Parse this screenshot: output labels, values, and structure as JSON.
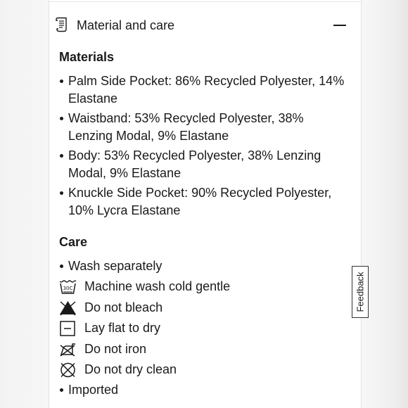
{
  "accordion": {
    "title": "Material and care",
    "icon": "document-icon",
    "toggle_icon": "minus-icon"
  },
  "materials": {
    "heading": "Materials",
    "items": [
      "Palm Side Pocket: 86% Recycled Polyester, 14% Elastane",
      "Waistband: 53% Recycled Polyester, 38% Lenzing Modal, 9% Elastane",
      "Body: 53% Recycled Polyester, 38% Lenzing Modal, 9% Elastane",
      "Knuckle Side Pocket: 90% Recycled Polyester, 10% Lycra Elastane"
    ]
  },
  "care": {
    "heading": "Care",
    "items": [
      {
        "label": "Wash separately",
        "icon": "bullet"
      },
      {
        "label": "Machine wash cold gentle",
        "icon": "wash-30c-icon",
        "icon_text": "30C"
      },
      {
        "label": "Do not bleach",
        "icon": "do-not-bleach-icon"
      },
      {
        "label": "Lay flat to dry",
        "icon": "lay-flat-dry-icon"
      },
      {
        "label": "Do not iron",
        "icon": "do-not-iron-icon"
      },
      {
        "label": "Do not dry clean",
        "icon": "do-not-dry-clean-icon"
      },
      {
        "label": "Imported",
        "icon": "bullet"
      }
    ]
  },
  "feedback": {
    "label": "Feedback"
  },
  "colors": {
    "text": "#1a1a1a",
    "panel": "#ffffff",
    "background": "#f5f5f5",
    "border": "#e3e3e3"
  }
}
